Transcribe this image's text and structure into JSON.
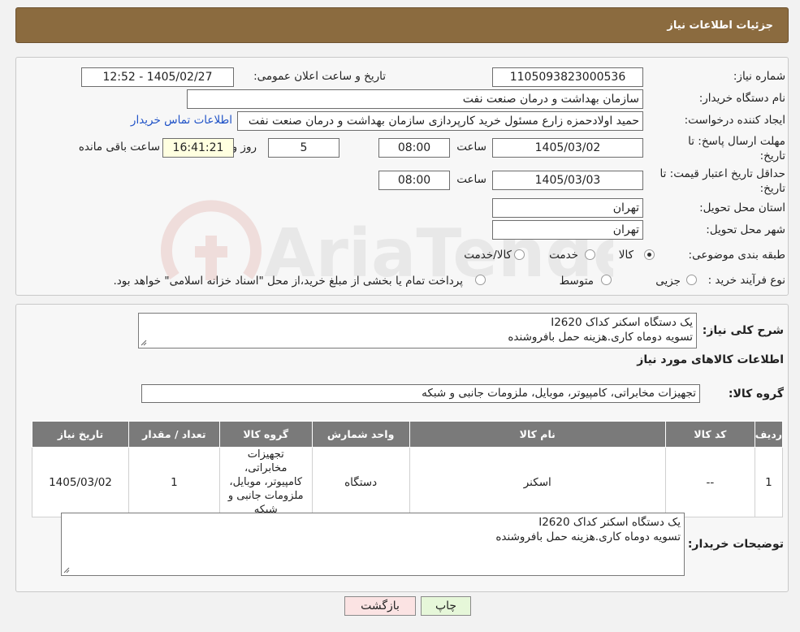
{
  "header": {
    "title": "جزئیات اطلاعات نیاز"
  },
  "form": {
    "need_number_label": "شماره نیاز:",
    "need_number": "1105093823000536",
    "announce_label": "تاریخ و ساعت اعلان عمومی:",
    "announce_value": "1405/02/27 - 12:52",
    "buyer_org_label": "نام دستگاه خریدار:",
    "buyer_org": "سازمان بهداشت و درمان صنعت نفت",
    "requester_label": "ایجاد کننده درخواست:",
    "requester": "حمید اولادحمزه زارع مسئول خرید کارپردازی سازمان بهداشت و درمان صنعت نفت",
    "contact_link": "اطلاعات تماس خریدار",
    "reply_deadline_label": "مهلت ارسال پاسخ: تا تاریخ:",
    "reply_date": "1405/03/02",
    "time_label": "ساعت",
    "reply_time": "08:00",
    "days": "5",
    "days_label": "روز و",
    "remaining_time": "16:41:21",
    "remaining_label": "ساعت باقی مانده",
    "validity_label": "حداقل تاریخ اعتبار قیمت: تا تاریخ:",
    "validity_date": "1405/03/03",
    "validity_time": "08:00",
    "province_label": "استان محل تحویل:",
    "province": "تهران",
    "city_label": "شهر محل تحویل:",
    "city": "تهران",
    "category_label": "طبقه بندی موضوعی:",
    "category_options": [
      "کالا",
      "خدمت",
      "کالا/خدمت"
    ],
    "process_label": "نوع فرآیند خرید :",
    "process_options": [
      "جزیی",
      "متوسط"
    ],
    "process_note": "پرداخت تمام یا بخشی از مبلغ خرید،از محل \"اسناد خزانه اسلامی\" خواهد بود."
  },
  "summary": {
    "label": "شرح کلی نیاز:",
    "line1": "یک دستگاه اسکنر کداک I2620",
    "line2": "تسویه دوماه کاری.هزینه حمل بافروشنده",
    "goods_info_title": "اطلاعات کالاهای مورد نیاز",
    "goods_group_label": "گروه کالا:",
    "goods_group": "تجهیزات مخابراتی، کامپیوتر، موبایل، ملزومات جانبی و شبکه"
  },
  "table": {
    "headers": [
      "ردیف",
      "کد کالا",
      "نام کالا",
      "واحد شمارش",
      "گروه کالا",
      "تعداد / مقدار",
      "تاریخ نیاز"
    ],
    "rows": [
      [
        "1",
        "--",
        "اسکنر",
        "دستگاه",
        "تجهیزات مخابراتی، کامپیوتر، موبایل، ملزومات جانبی و شبکه",
        "1",
        "1405/03/02"
      ]
    ]
  },
  "buyer_notes": {
    "label": "توضیحات خریدار:",
    "line1": "یک دستگاه اسکنر کداک I2620",
    "line2": "تسویه دوماه کاری.هزینه حمل بافروشنده"
  },
  "buttons": {
    "print": "چاپ",
    "back": "بازگشت"
  },
  "colors": {
    "header_bg": "#8b6b3f",
    "print_bg": "#e6f7d9",
    "back_bg": "#fbe3e3",
    "link": "#1f52c7"
  },
  "watermark": {
    "text": "AriaTender.neT"
  }
}
